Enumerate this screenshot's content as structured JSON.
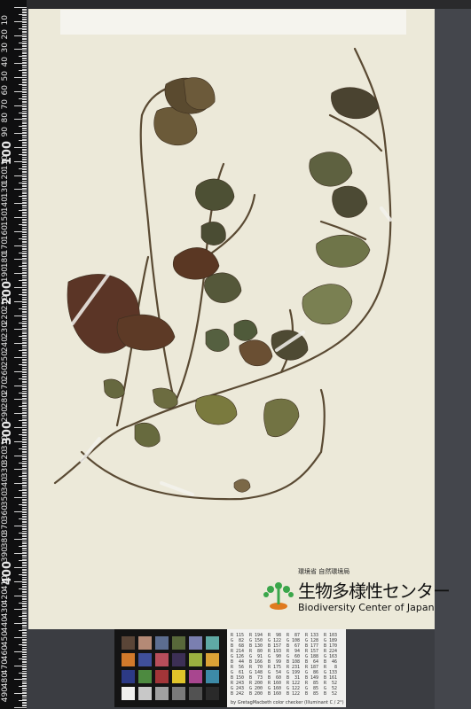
{
  "ruler": {
    "labels": [
      "10",
      "20",
      "30",
      "40",
      "50",
      "60",
      "70",
      "80",
      "90",
      "100",
      "110",
      "120",
      "130",
      "140",
      "150",
      "160",
      "170",
      "180",
      "190",
      "200",
      "210",
      "220",
      "230",
      "240",
      "250",
      "260",
      "270",
      "280",
      "290",
      "300",
      "310",
      "320",
      "330",
      "340",
      "350",
      "360",
      "370",
      "380",
      "390",
      "400",
      "410",
      "420",
      "430",
      "440",
      "450",
      "460",
      "470",
      "480",
      "490",
      "500"
    ]
  },
  "logo": {
    "ministry": "環境省 自然環境局",
    "name_jp": "生物多様性センター",
    "name_en": "Biodiversity Center of Japan"
  },
  "color_chart": {
    "swatches": [
      "#5a4537",
      "#b48a76",
      "#5c6d90",
      "#58683a",
      "#7a7fb0",
      "#5fa9a5",
      "#d27a2b",
      "#3f4f9a",
      "#b84e5b",
      "#3c2f55",
      "#9bb040",
      "#dba236",
      "#2c3a86",
      "#4d8a40",
      "#a23538",
      "#e0c42a",
      "#a8468f",
      "#3d8aa7",
      "#f0f0ee",
      "#c8c8c8",
      "#a0a0a0",
      "#7a7a7a",
      "#525252",
      "#2a2a2a"
    ]
  },
  "gray_card": {
    "columns": [
      "R 115\nG  82\nB  68\nR 214\nG 126\nB  44\nR  56\nG  61\nB 150\nR 243\nG 243\nB 242",
      "R 194\nG 150\nB 130\nR  80\nG  91\nB 166\nR  70\nG 148\nB  73\nR 200\nG 200\nB 200",
      "R  98\nG 122\nB 157\nR 193\nG  90\nB  99\nR 175\nG  54\nB  60\nR 160\nG 160\nB 160",
      "R  87\nG 108\nB  67\nR  94\nG  60\nB 108\nR 231\nG 199\nB  31\nR 122\nG 122\nB 122",
      "R 133\nG 128\nB 177\nR 157\nG 188\nB  64\nR 187\nG  86\nB 149\nR  85\nG  85\nB  85",
      "R 103\nG 189\nB 170\nR 224\nG 163\nB  46\nR   8\nG 133\nB 161\nR  52\nG  52\nB  52"
    ],
    "footer": "by GretagMacbeth color checker (Illuminant C / 2°)"
  }
}
